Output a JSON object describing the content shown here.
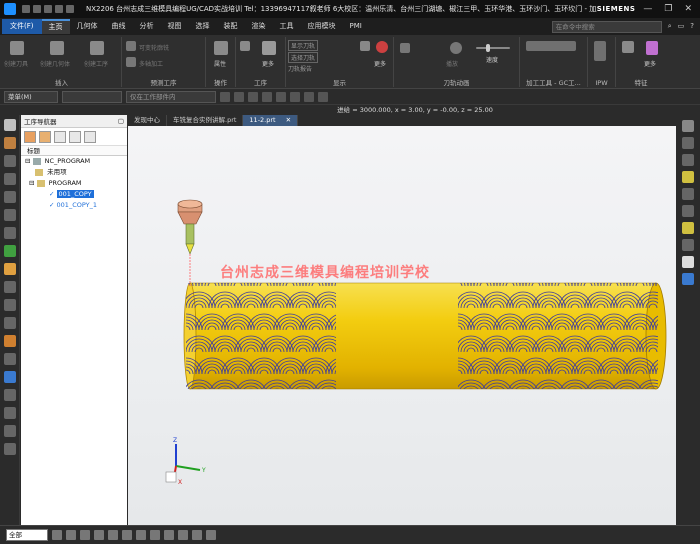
{
  "window": {
    "title": "NX2206 台州志成三维模具编程UG/CAD实战培训  Tel：13396947117叙老师 6大校区：温州乐清、台州三门湖塘、椒江三甲、玉环华港、玉环沙门、玉环坎门 - 加工",
    "brand": "SIEMENS"
  },
  "menu": {
    "file": "文件(F)",
    "items": [
      "主页",
      "几何体",
      "曲线",
      "分析",
      "视图",
      "选择",
      "装配",
      "渲染",
      "工具",
      "应用模块",
      "PMI"
    ],
    "active": "主页",
    "search_placeholder": "在命令中搜索"
  },
  "ribbon": {
    "groups": [
      {
        "label": "插入",
        "items": [
          "创建刀具",
          "创建几何体",
          "创建工序"
        ]
      },
      {
        "label": "预测工序",
        "items": [
          "可变轮廓铣",
          "多轴加工"
        ]
      },
      {
        "label": "操作",
        "items": [
          "属性"
        ]
      },
      {
        "label": "工序",
        "items": [
          "更多"
        ]
      },
      {
        "label": "显示",
        "items": [
          "显示刀轨",
          "选择刀轨",
          "刀轨报告",
          "更多"
        ]
      },
      {
        "label": "刀轨动画",
        "items": [
          "播放",
          "速度"
        ]
      },
      {
        "label": "加工工具 - GC工...",
        "items": []
      },
      {
        "label": "IPW",
        "items": []
      },
      {
        "label": "特征",
        "items": [
          "更多"
        ]
      }
    ]
  },
  "toolbar2": {
    "menu": "菜单(M)",
    "filter": "",
    "scope": "仅在工作部件内"
  },
  "status": {
    "text": "进给 = 3000.000, x = 3.00, y = -0.00, z = 25.00"
  },
  "navigator": {
    "title": "工序导航器",
    "column": "标题",
    "tree": [
      {
        "label": "NC_PROGRAM",
        "level": 0,
        "type": "root"
      },
      {
        "label": "未用项",
        "level": 1,
        "type": "folder"
      },
      {
        "label": "PROGRAM",
        "level": 1,
        "type": "folder"
      },
      {
        "label": "001_COPY",
        "level": 2,
        "type": "op",
        "selected": true
      },
      {
        "label": "001_COPY_1",
        "level": 2,
        "type": "op",
        "selected": false
      }
    ]
  },
  "tabs": [
    {
      "label": "发现中心",
      "active": false
    },
    {
      "label": "车铣复合实例讲解.prt",
      "active": false
    },
    {
      "label": "11-2.prt",
      "active": true
    }
  ],
  "viewport": {
    "watermark": "台州志成三维模具编程培训学校",
    "axes": {
      "x": "X",
      "y": "Y",
      "z": "Z"
    },
    "colors": {
      "part": "#f0c000",
      "toolpath": "#3a3aa0",
      "tool_holder": "#e8a080",
      "tool": "#a8c060"
    }
  },
  "bottombar": {
    "filter": "全部"
  }
}
